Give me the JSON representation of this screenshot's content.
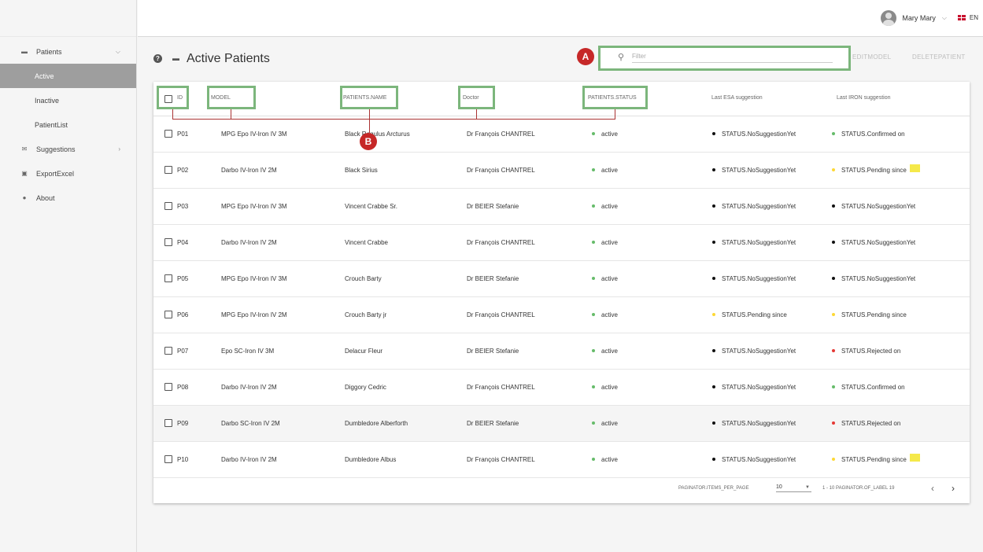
{
  "sidebar": {
    "items": [
      {
        "label": "Patients",
        "icon": "bed-icon"
      },
      {
        "label": "Active"
      },
      {
        "label": "Inactive"
      },
      {
        "label": "PatientList"
      },
      {
        "label": "Suggestions",
        "icon": "envelope-icon"
      },
      {
        "label": "ExportExcel",
        "icon": "floppy-icon"
      },
      {
        "label": "About",
        "icon": "info-icon"
      }
    ]
  },
  "topbar": {
    "user_name": "Mary Mary",
    "language": "EN"
  },
  "page": {
    "title": "Active Patients",
    "filter_placeholder": "Filter",
    "edit_model": "EDITMODEL",
    "delete_patient": "DELETEPATIENT",
    "marker_a": "A",
    "marker_b": "B"
  },
  "table": {
    "headers": [
      "ID",
      "MODEL",
      "PATIENTS.NAME",
      "Doctor",
      "PATIENTS.STATUS",
      "Last ESA suggestion",
      "Last IRON suggestion"
    ],
    "rows": [
      {
        "id": "P01",
        "model": "MPG Epo IV-Iron IV 3M",
        "name": "Black Regulus Arcturus",
        "doctor": "Dr François CHANTREL",
        "status": "active",
        "esa": "STATUS.NoSuggestionYet",
        "esa_color": "#111111",
        "iron": "STATUS.Confirmed on",
        "iron_color": "#66bb6a",
        "note": false
      },
      {
        "id": "P02",
        "model": "Darbo IV-Iron IV 2M",
        "name": "Black Sirius",
        "doctor": "Dr François CHANTREL",
        "status": "active",
        "esa": "STATUS.NoSuggestionYet",
        "esa_color": "#111111",
        "iron": "STATUS.Pending since",
        "iron_color": "#fdd835",
        "note": true
      },
      {
        "id": "P03",
        "model": "MPG Epo IV-Iron IV 3M",
        "name": "Vincent Crabbe Sr.",
        "doctor": "Dr BEIER Stefanie",
        "status": "active",
        "esa": "STATUS.NoSuggestionYet",
        "esa_color": "#111111",
        "iron": "STATUS.NoSuggestionYet",
        "iron_color": "#111111",
        "note": false
      },
      {
        "id": "P04",
        "model": "Darbo IV-Iron IV 2M",
        "name": "Vincent Crabbe",
        "doctor": "Dr François CHANTREL",
        "status": "active",
        "esa": "STATUS.NoSuggestionYet",
        "esa_color": "#111111",
        "iron": "STATUS.NoSuggestionYet",
        "iron_color": "#111111",
        "note": false
      },
      {
        "id": "P05",
        "model": "MPG Epo IV-Iron IV 3M",
        "name": "Crouch Barty",
        "doctor": "Dr BEIER Stefanie",
        "status": "active",
        "esa": "STATUS.NoSuggestionYet",
        "esa_color": "#111111",
        "iron": "STATUS.NoSuggestionYet",
        "iron_color": "#111111",
        "note": false
      },
      {
        "id": "P06",
        "model": "MPG Epo IV-Iron IV 2M",
        "name": "Crouch Barty jr",
        "doctor": "Dr François CHANTREL",
        "status": "active",
        "esa": "STATUS.Pending since",
        "esa_color": "#fdd835",
        "iron": "STATUS.Pending since",
        "iron_color": "#fdd835",
        "note": false
      },
      {
        "id": "P07",
        "model": "Epo SC-Iron IV 3M",
        "name": "Delacur Fleur",
        "doctor": "Dr BEIER Stefanie",
        "status": "active",
        "esa": "STATUS.NoSuggestionYet",
        "esa_color": "#111111",
        "iron": "STATUS.Rejected on",
        "iron_color": "#e53935",
        "note": false
      },
      {
        "id": "P08",
        "model": "Darbo IV-Iron IV 2M",
        "name": "Diggory Cedric",
        "doctor": "Dr François CHANTREL",
        "status": "active",
        "esa": "STATUS.NoSuggestionYet",
        "esa_color": "#111111",
        "iron": "STATUS.Confirmed on",
        "iron_color": "#66bb6a",
        "note": false
      },
      {
        "id": "P09",
        "model": "Darbo SC-Iron IV 2M",
        "name": "Dumbledore Alberforth",
        "doctor": "Dr BEIER Stefanie",
        "status": "active",
        "esa": "STATUS.NoSuggestionYet",
        "esa_color": "#111111",
        "iron": "STATUS.Rejected on",
        "iron_color": "#e53935",
        "note": false
      },
      {
        "id": "P10",
        "model": "Darbo IV-Iron IV 2M",
        "name": "Dumbledore Albus",
        "doctor": "Dr François CHANTREL",
        "status": "active",
        "esa": "STATUS.NoSuggestionYet",
        "esa_color": "#111111",
        "iron": "STATUS.Pending since",
        "iron_color": "#fdd835",
        "note": true
      }
    ]
  },
  "paginator": {
    "items_per_page_label": "PAGINATOR.ITEMS_PER_PAGE",
    "page_size": "10",
    "range_label": "1 - 10 PAGINATOR.OF_LABEL 19"
  },
  "colors": {
    "status_active": "#66bb6a",
    "highlight": "#7cb67c",
    "marker": "#c62828",
    "active_nav": "#9e9e9e"
  }
}
